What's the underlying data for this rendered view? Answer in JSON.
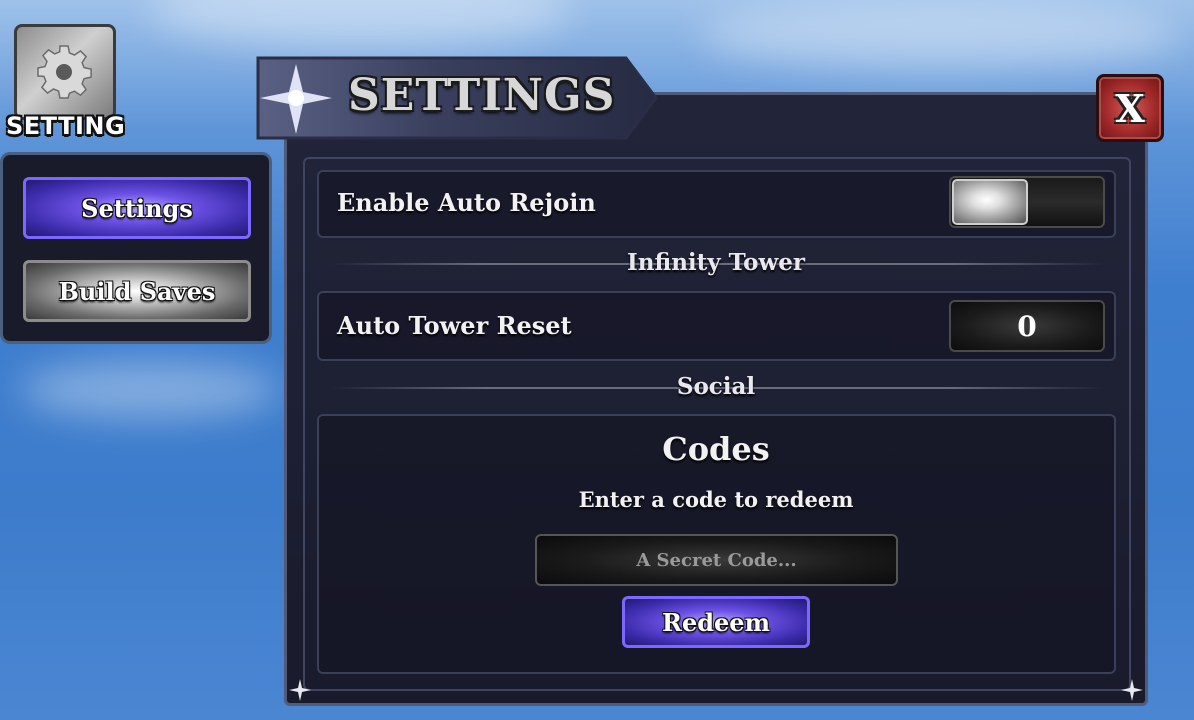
{
  "sidebar_button": {
    "label": "SETTING",
    "icon": "gear-icon"
  },
  "nav": {
    "items": [
      {
        "label": "Settings",
        "active": true
      },
      {
        "label": "Build Saves",
        "active": false
      }
    ]
  },
  "window": {
    "title": "SETTINGS",
    "close_label": "X",
    "title_icon": "sparkle-star-icon"
  },
  "settings": {
    "auto_rejoin": {
      "label": "Enable Auto Rejoin",
      "enabled": false
    }
  },
  "infinity_tower": {
    "section_title": "Infinity Tower",
    "auto_tower_reset": {
      "label": "Auto Tower Reset",
      "value": "0"
    }
  },
  "social": {
    "section_title": "Social",
    "codes": {
      "title": "Codes",
      "subtitle": "Enter a code to redeem",
      "input_value": "",
      "placeholder": "A Secret Code...",
      "redeem_label": "Redeem"
    }
  },
  "colors": {
    "accent_purple": "#6d52e6",
    "panel_bg": "#1a1b2a",
    "close_red": "#a32b2b",
    "sky_blue": "#3f7fd0"
  }
}
